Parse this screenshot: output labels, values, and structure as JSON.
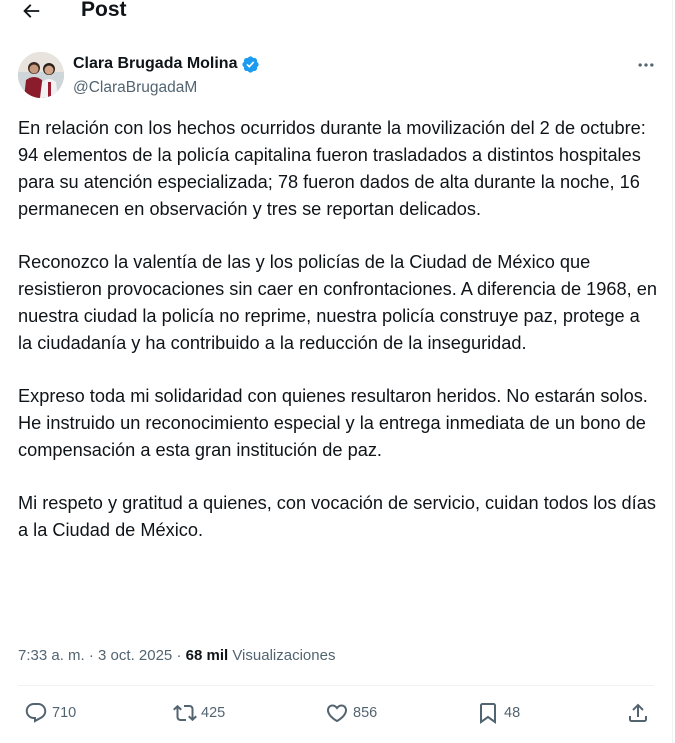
{
  "header": {
    "title": "Post",
    "back_icon": "arrow-left-icon"
  },
  "author": {
    "name": "Clara Brugada Molina",
    "handle": "@ClaraBrugadaM",
    "verified": true,
    "verified_color": "#1d9bf0"
  },
  "tweet": {
    "paragraphs": [
      [
        "En relación con los hechos ocurridos durante la movilización del 2 de octubre:",
        "94 elementos de la policía capitalina fueron trasladados a distintos hospitales para su atención especializada; 78 fueron dados de alta durante la noche, 16 permanecen en observación y tres se reportan delicados."
      ],
      [
        "Reconozco la valentía de las y los policías de la Ciudad de México que resistieron provocaciones sin caer en confrontaciones. A diferencia de 1968, en nuestra ciudad la policía no reprime, nuestra policía construye paz, protege a la ciudadanía y ha contribuido a la reducción de la inseguridad."
      ],
      [
        "Expreso toda mi solidaridad con quienes resultaron heridos. No estarán solos. He instruido un reconocimiento especial y la entrega inmediata de un bono de compensación a esta gran institución de paz."
      ],
      [
        "Mi respeto y gratitud a quienes, con vocación de servicio, cuidan todos los días a la Ciudad de México."
      ]
    ]
  },
  "meta": {
    "time": "7:33 a. m.",
    "separator": "·",
    "date": "3 oct. 2025",
    "views_count": "68 mil",
    "views_label": "Visualizaciones"
  },
  "actions": {
    "replies": "710",
    "reposts": "425",
    "likes": "856",
    "bookmarks": "48"
  },
  "colors": {
    "text": "#0f1419",
    "secondary": "#536471",
    "border": "#eff3f4",
    "accent": "#1d9bf0"
  }
}
